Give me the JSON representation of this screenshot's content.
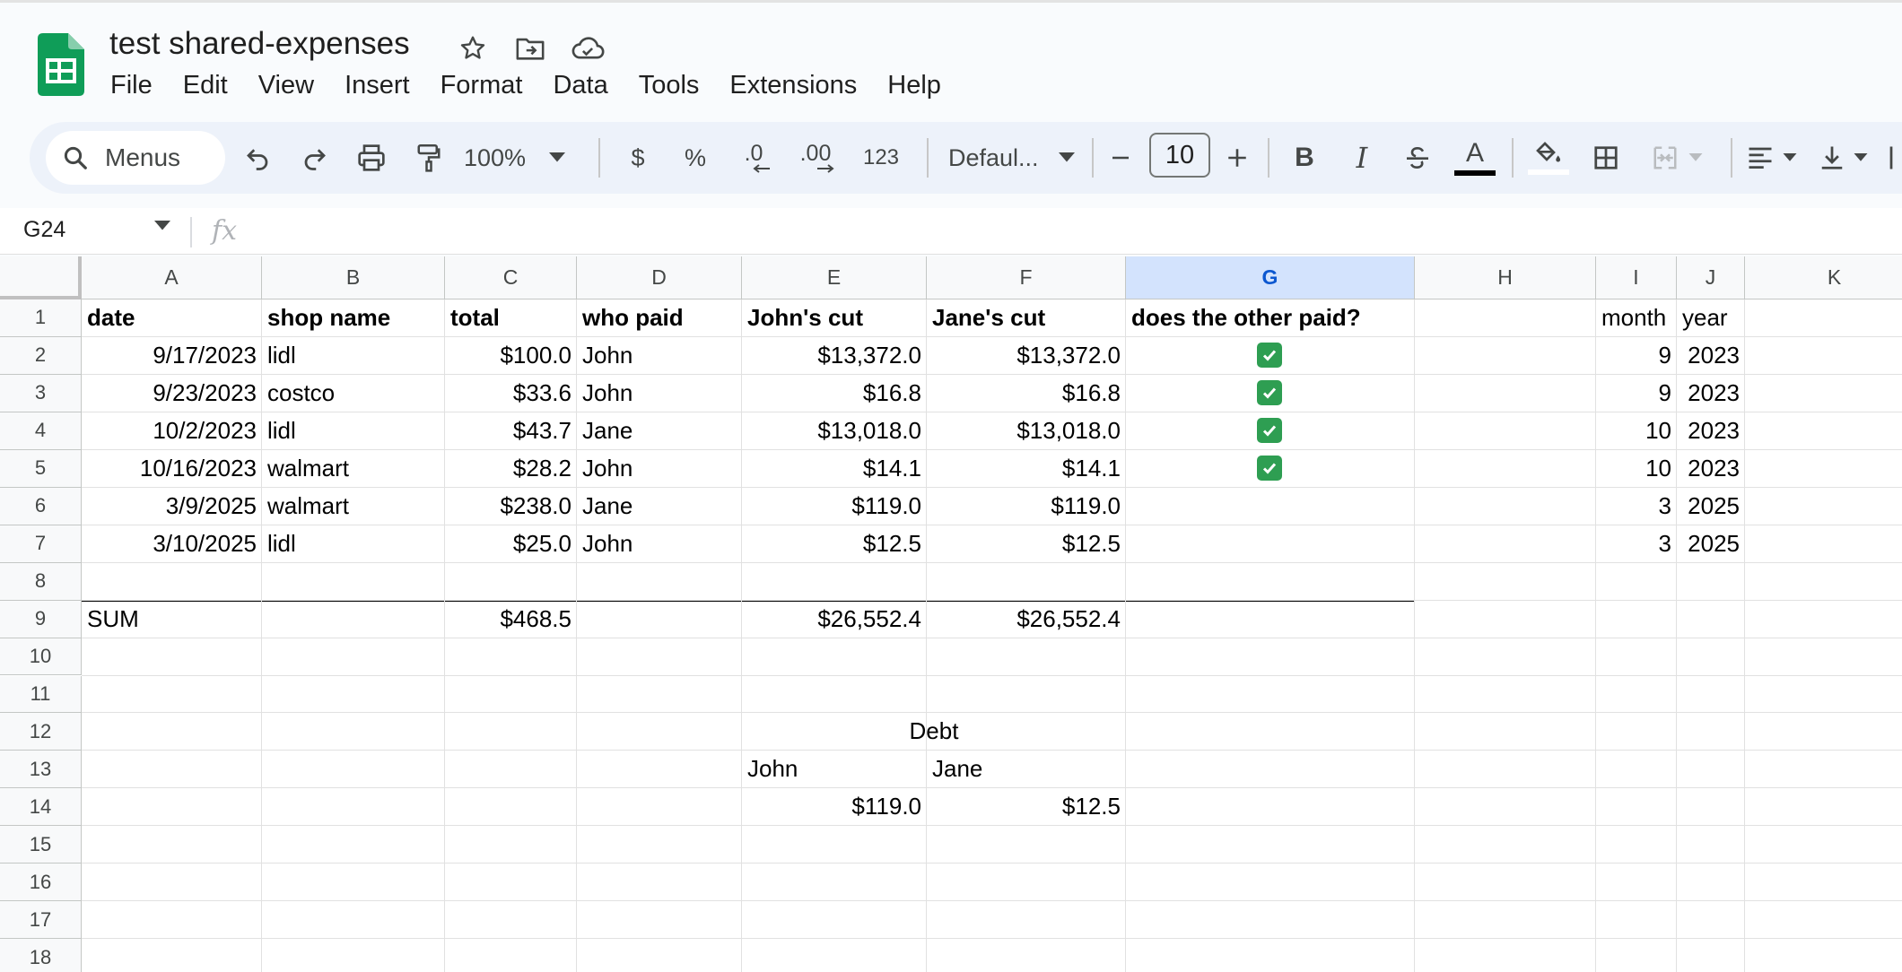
{
  "app": {
    "doc_title": "test shared-expenses",
    "menu": [
      "File",
      "Edit",
      "View",
      "Insert",
      "Format",
      "Data",
      "Tools",
      "Extensions",
      "Help"
    ]
  },
  "toolbar": {
    "search_label": "Menus",
    "zoom": "100%",
    "currency": "$",
    "percent": "%",
    "decrease_decimal": ".0",
    "increase_decimal": ".00",
    "number_format": "123",
    "font_name": "Defaul...",
    "font_size": "10",
    "bold": "B",
    "italic": "I",
    "text_color_letter": "A"
  },
  "formula_bar": {
    "cell_ref": "G24",
    "fx": "fx",
    "content": ""
  },
  "columns": [
    "A",
    "B",
    "C",
    "D",
    "E",
    "F",
    "G",
    "H",
    "I",
    "J",
    "K"
  ],
  "selected_column": "G",
  "rows": [
    "1",
    "2",
    "3",
    "4",
    "5",
    "6",
    "7",
    "8",
    "9",
    "10",
    "11",
    "12",
    "13",
    "14",
    "15",
    "16",
    "17",
    "18"
  ],
  "headers": {
    "date": "date",
    "shop": "shop name",
    "total": "total",
    "payer": "who paid",
    "john_cut": "John's cut",
    "jane_cut": "Jane's cut",
    "paid": "does the other paid?",
    "month": "month",
    "year": "year"
  },
  "expenses": [
    {
      "date": "9/17/2023",
      "shop": "lidl",
      "total": "$100.0",
      "payer": "John",
      "john_cut": "$13,372.0",
      "jane_cut": "$13,372.0",
      "paid": true,
      "month": "9",
      "year": "2023"
    },
    {
      "date": "9/23/2023",
      "shop": "costco",
      "total": "$33.6",
      "payer": "John",
      "john_cut": "$16.8",
      "jane_cut": "$16.8",
      "paid": true,
      "month": "9",
      "year": "2023"
    },
    {
      "date": "10/2/2023",
      "shop": "lidl",
      "total": "$43.7",
      "payer": "Jane",
      "john_cut": "$13,018.0",
      "jane_cut": "$13,018.0",
      "paid": true,
      "month": "10",
      "year": "2023"
    },
    {
      "date": "10/16/2023",
      "shop": "walmart",
      "total": "$28.2",
      "payer": "John",
      "john_cut": "$14.1",
      "jane_cut": "$14.1",
      "paid": true,
      "month": "10",
      "year": "2023"
    },
    {
      "date": "3/9/2025",
      "shop": "walmart",
      "total": "$238.0",
      "payer": "Jane",
      "john_cut": "$119.0",
      "jane_cut": "$119.0",
      "paid": false,
      "month": "3",
      "year": "2025"
    },
    {
      "date": "3/10/2025",
      "shop": "lidl",
      "total": "$25.0",
      "payer": "John",
      "john_cut": "$12.5",
      "jane_cut": "$12.5",
      "paid": false,
      "month": "3",
      "year": "2025"
    }
  ],
  "sum": {
    "label": "SUM",
    "total": "$468.5",
    "john_cut": "$26,552.4",
    "jane_cut": "$26,552.4"
  },
  "debt": {
    "title": "Debt",
    "john_label": "John",
    "jane_label": "Jane",
    "john_value": "$119.0",
    "jane_value": "$12.5"
  },
  "colors": {
    "selected_header": "#d3e3fd",
    "toolbar_bg": "#edf2fa",
    "sheets_green": "#0f9d58",
    "checkmark_green": "#2e9e52"
  }
}
